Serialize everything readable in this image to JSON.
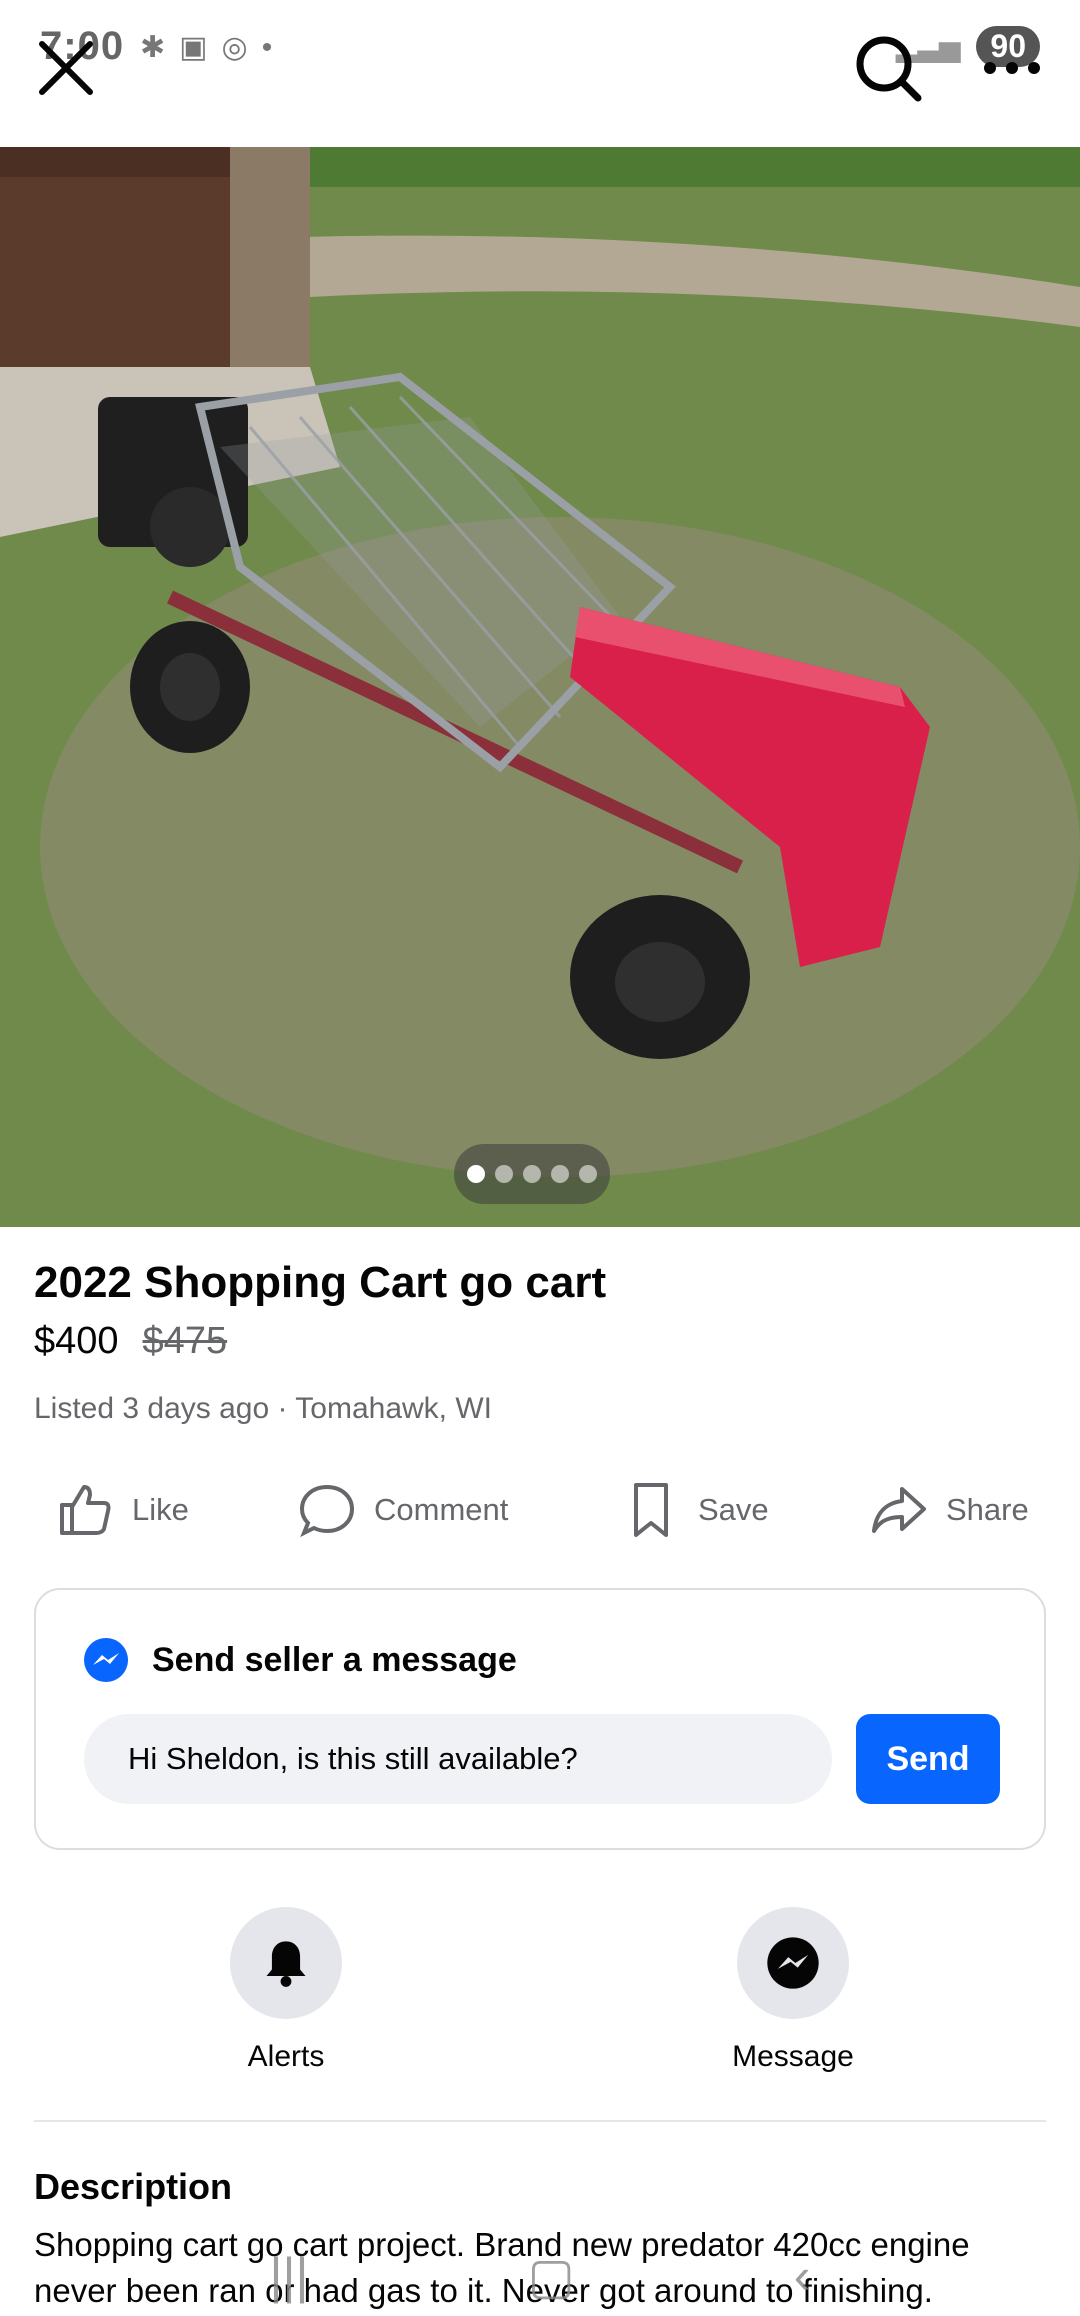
{
  "status_bar": {
    "time": "7:00",
    "battery": "90"
  },
  "listing": {
    "title": "2022 Shopping Cart go cart",
    "price": "$400",
    "original_price": "$475",
    "meta": "Listed 3 days ago · Tomahawk, WI",
    "photo_count": 5,
    "active_photo": 1
  },
  "actions": {
    "like": "Like",
    "comment": "Comment",
    "save": "Save",
    "share": "Share"
  },
  "message_card": {
    "heading": "Send seller a message",
    "input_value": "Hi Sheldon, is this still available?",
    "send_label": "Send"
  },
  "quick_actions": {
    "alerts": "Alerts",
    "message": "Message"
  },
  "description": {
    "heading": "Description",
    "text": "Shopping cart go cart project. Brand new predator 420cc engine never been ran or had gas to it. Never got around to finishing."
  },
  "colors": {
    "accent": "#0866ff",
    "secondary_text": "#65676b",
    "button_bg": "#e4e6eb"
  }
}
